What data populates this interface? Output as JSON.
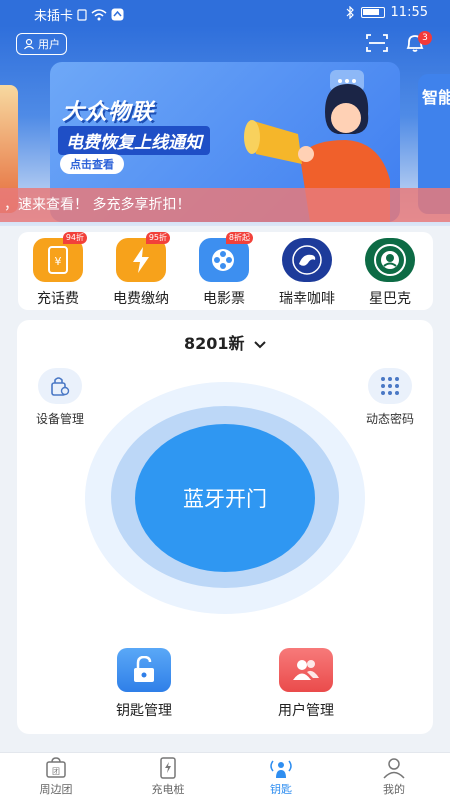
{
  "status": {
    "carrier": "未插卡",
    "time": "11:55"
  },
  "topbar": {
    "user_label": "用户",
    "notification_count": "3"
  },
  "banner": {
    "title": "大众物联",
    "subtitle": "电费恢复上线通知",
    "button": "点击查看",
    "next_title": "智能"
  },
  "marquee": {
    "text": "，速来查看！ 多充多享折扣！"
  },
  "shortcuts": [
    {
      "label": "充话费",
      "badge": "94折",
      "color": "#f7a21b"
    },
    {
      "label": "电费缴纳",
      "badge": "95折",
      "color": "#f7a21b"
    },
    {
      "label": "电影票",
      "badge": "8折起",
      "color": "#3d8ff0"
    },
    {
      "label": "瑞幸咖啡",
      "badge": "",
      "color": "#1d3b9a"
    },
    {
      "label": "星巴克",
      "badge": "",
      "color": "#0d6b45"
    }
  ],
  "door": {
    "device_name": "8201新",
    "device_mgmt": "设备管理",
    "dynamic_pwd": "动态密码",
    "open_label": "蓝牙开门",
    "key_mgmt": "钥匙管理",
    "user_mgmt": "用户管理"
  },
  "tabs": [
    {
      "label": "周边团"
    },
    {
      "label": "充电桩"
    },
    {
      "label": "钥匙"
    },
    {
      "label": "我的"
    }
  ],
  "colors": {
    "primary": "#2f6fdb",
    "accent": "#2f97f2",
    "active_tab": "#2f8ef0"
  }
}
